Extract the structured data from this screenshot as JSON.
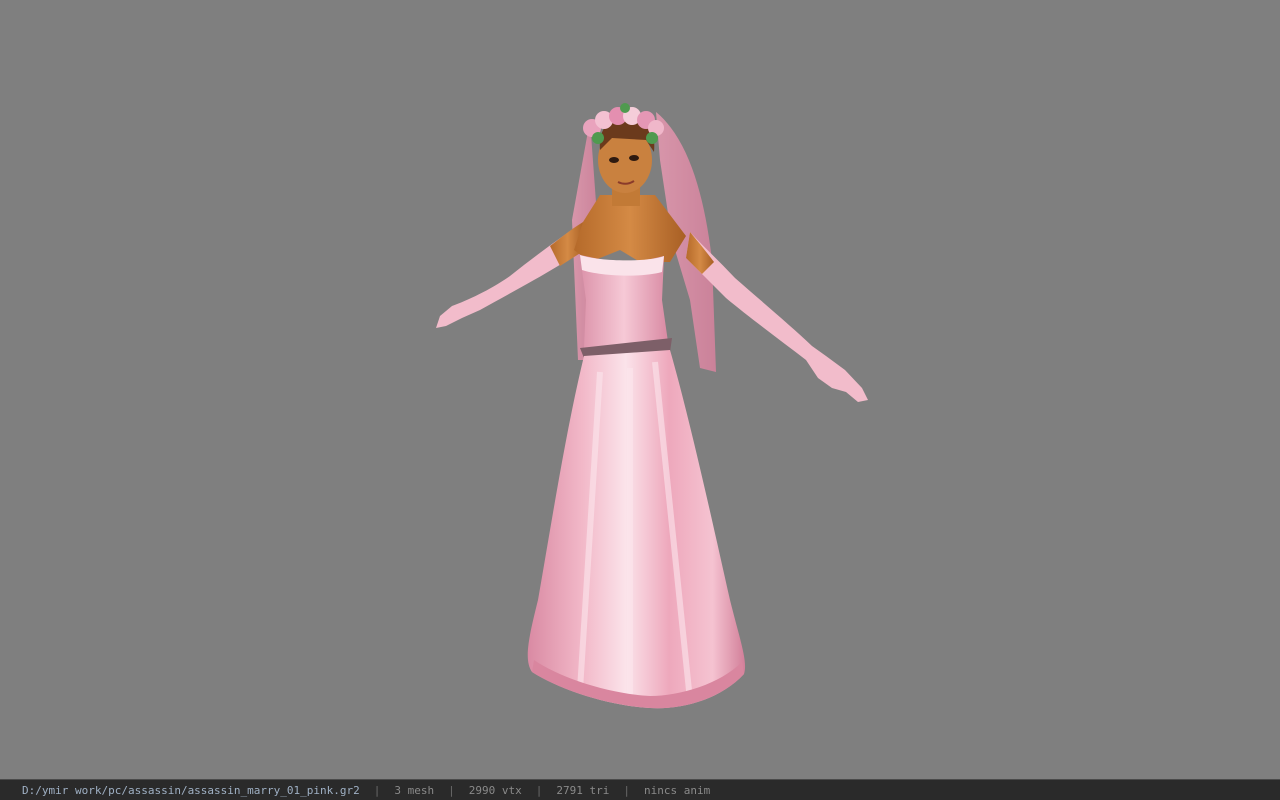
{
  "viewport": {
    "background": "#7f7f7f",
    "model": "pink wedding dress character model (T-pose)"
  },
  "status": {
    "file_path": "D:/ymir work/pc/assassin/assassin_marry_01_pink.gr2",
    "separator": "|",
    "mesh": "3 mesh",
    "vertices": "2990 vtx",
    "triangles": "2791 tri",
    "animation": "nincs anim"
  }
}
